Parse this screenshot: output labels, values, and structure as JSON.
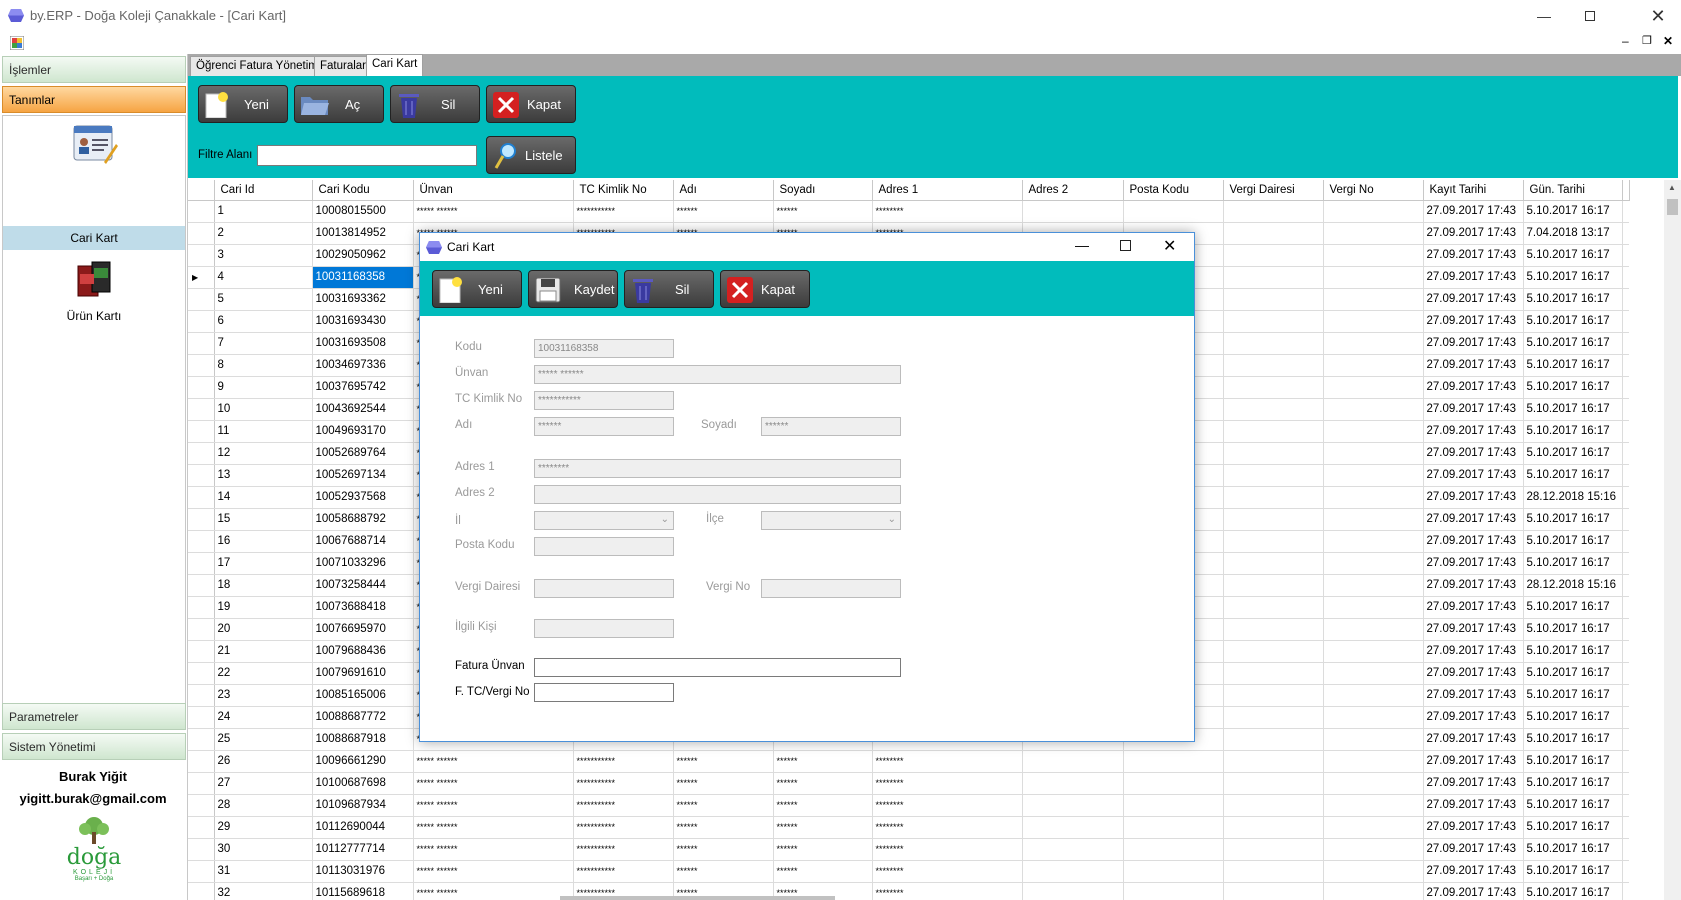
{
  "window": {
    "title": "by.ERP - Doğa Koleji Çanakkale - [Cari Kart]"
  },
  "sidebar": {
    "sections": [
      "İşlemler",
      "Tanımlar",
      "Parametreler",
      "Sistem Yönetimi"
    ],
    "items": [
      "Cari Kart",
      "Ürün Kartı"
    ],
    "user_name": "Burak Yiğit",
    "user_email": "yigitt.burak@gmail.com",
    "logo_text": "doğa",
    "logo_sub": "KOLEJİ",
    "logo_tag": "Başarı + Doğa"
  },
  "tabs": [
    "Öğrenci Fatura Yönetimi",
    "Faturalar",
    "Cari Kart"
  ],
  "toolbar": {
    "new": "Yeni",
    "open": "Aç",
    "delete": "Sil",
    "close": "Kapat"
  },
  "filter": {
    "label": "Filtre Alanı",
    "value": "",
    "list_button": "Listele"
  },
  "grid": {
    "columns": [
      "Cari Id",
      "Cari Kodu",
      "Ünvan",
      "TC Kimlik No",
      "Adı",
      "Soyadı",
      "Adres 1",
      "Adres 2",
      "Posta Kodu",
      "Vergi Dairesi",
      "Vergi No",
      "Kayıt Tarihi",
      "Gün. Tarihi"
    ],
    "rows": [
      [
        "1",
        "10008015500",
        "***** ******",
        "***********",
        "******",
        "******",
        "********",
        "",
        "",
        "",
        "",
        "27.09.2017 17:43",
        "5.10.2017 16:17"
      ],
      [
        "2",
        "10013814952",
        "***** ******",
        "***********",
        "******",
        "******",
        "********",
        "",
        "",
        "",
        "",
        "27.09.2017 17:43",
        "7.04.2018 13:17"
      ],
      [
        "3",
        "10029050962",
        "***** ******",
        "***********",
        "******",
        "******",
        "********",
        "",
        "",
        "",
        "",
        "27.09.2017 17:43",
        "5.10.2017 16:17"
      ],
      [
        "4",
        "10031168358",
        "***** ******",
        "***********",
        "******",
        "******",
        "********",
        "",
        "",
        "",
        "",
        "27.09.2017 17:43",
        "5.10.2017 16:17"
      ],
      [
        "5",
        "10031693362",
        "***** ******",
        "***********",
        "******",
        "******",
        "********",
        "",
        "",
        "",
        "",
        "27.09.2017 17:43",
        "5.10.2017 16:17"
      ],
      [
        "6",
        "10031693430",
        "***** ******",
        "***********",
        "******",
        "******",
        "********",
        "",
        "",
        "",
        "",
        "27.09.2017 17:43",
        "5.10.2017 16:17"
      ],
      [
        "7",
        "10031693508",
        "***** ******",
        "***********",
        "******",
        "******",
        "********",
        "",
        "",
        "",
        "",
        "27.09.2017 17:43",
        "5.10.2017 16:17"
      ],
      [
        "8",
        "10034697336",
        "***** ******",
        "***********",
        "******",
        "******",
        "********",
        "",
        "",
        "",
        "",
        "27.09.2017 17:43",
        "5.10.2017 16:17"
      ],
      [
        "9",
        "10037695742",
        "***** ******",
        "***********",
        "******",
        "******",
        "********",
        "",
        "",
        "",
        "",
        "27.09.2017 17:43",
        "5.10.2017 16:17"
      ],
      [
        "10",
        "10043692544",
        "***** ******",
        "***********",
        "******",
        "******",
        "********",
        "",
        "",
        "",
        "",
        "27.09.2017 17:43",
        "5.10.2017 16:17"
      ],
      [
        "11",
        "10049693170",
        "***** ******",
        "***********",
        "******",
        "******",
        "********",
        "",
        "",
        "",
        "",
        "27.09.2017 17:43",
        "5.10.2017 16:17"
      ],
      [
        "12",
        "10052689764",
        "***** ******",
        "***********",
        "******",
        "******",
        "********",
        "",
        "",
        "",
        "",
        "27.09.2017 17:43",
        "5.10.2017 16:17"
      ],
      [
        "13",
        "10052697134",
        "***** ******",
        "***********",
        "******",
        "******",
        "********",
        "",
        "",
        "",
        "",
        "27.09.2017 17:43",
        "5.10.2017 16:17"
      ],
      [
        "14",
        "10052937568",
        "***** ******",
        "***********",
        "******",
        "******",
        "********",
        "",
        "",
        "",
        "",
        "27.09.2017 17:43",
        "28.12.2018 15:16"
      ],
      [
        "15",
        "10058688792",
        "***** ******",
        "***********",
        "******",
        "******",
        "********",
        "",
        "",
        "",
        "",
        "27.09.2017 17:43",
        "5.10.2017 16:17"
      ],
      [
        "16",
        "10067688714",
        "***** ******",
        "***********",
        "******",
        "******",
        "********",
        "",
        "",
        "",
        "",
        "27.09.2017 17:43",
        "5.10.2017 16:17"
      ],
      [
        "17",
        "10071033296",
        "***** ******",
        "***********",
        "******",
        "******",
        "********",
        "",
        "",
        "",
        "",
        "27.09.2017 17:43",
        "5.10.2017 16:17"
      ],
      [
        "18",
        "10073258444",
        "***** ******",
        "***********",
        "******",
        "******",
        "********",
        "",
        "",
        "",
        "",
        "27.09.2017 17:43",
        "28.12.2018 15:16"
      ],
      [
        "19",
        "10073688418",
        "***** ******",
        "***********",
        "******",
        "******",
        "********",
        "",
        "",
        "",
        "",
        "27.09.2017 17:43",
        "5.10.2017 16:17"
      ],
      [
        "20",
        "10076695970",
        "***** ******",
        "***********",
        "******",
        "******",
        "********",
        "",
        "",
        "",
        "",
        "27.09.2017 17:43",
        "5.10.2017 16:17"
      ],
      [
        "21",
        "10079688436",
        "***** ******",
        "***********",
        "******",
        "******",
        "********",
        "",
        "",
        "",
        "",
        "27.09.2017 17:43",
        "5.10.2017 16:17"
      ],
      [
        "22",
        "10079691610",
        "***** ******",
        "***********",
        "******",
        "******",
        "********",
        "",
        "",
        "",
        "",
        "27.09.2017 17:43",
        "5.10.2017 16:17"
      ],
      [
        "23",
        "10085165006",
        "***** ******",
        "***********",
        "******",
        "******",
        "********",
        "",
        "",
        "",
        "",
        "27.09.2017 17:43",
        "5.10.2017 16:17"
      ],
      [
        "24",
        "10088687772",
        "***** ******",
        "***********",
        "******",
        "******",
        "********",
        "",
        "",
        "",
        "",
        "27.09.2017 17:43",
        "5.10.2017 16:17"
      ],
      [
        "25",
        "10088687918",
        "***** ******",
        "***********",
        "******",
        "******",
        "********",
        "",
        "",
        "",
        "",
        "27.09.2017 17:43",
        "5.10.2017 16:17"
      ],
      [
        "26",
        "10096661290",
        "***** ******",
        "***********",
        "******",
        "******",
        "********",
        "",
        "",
        "",
        "",
        "27.09.2017 17:43",
        "5.10.2017 16:17"
      ],
      [
        "27",
        "10100687698",
        "***** ******",
        "***********",
        "******",
        "******",
        "********",
        "",
        "",
        "",
        "",
        "27.09.2017 17:43",
        "5.10.2017 16:17"
      ],
      [
        "28",
        "10109687934",
        "***** ******",
        "***********",
        "******",
        "******",
        "********",
        "",
        "",
        "",
        "",
        "27.09.2017 17:43",
        "5.10.2017 16:17"
      ],
      [
        "29",
        "10112690044",
        "***** ******",
        "***********",
        "******",
        "******",
        "********",
        "",
        "",
        "",
        "",
        "27.09.2017 17:43",
        "5.10.2017 16:17"
      ],
      [
        "30",
        "10112777714",
        "***** ******",
        "***********",
        "******",
        "******",
        "********",
        "",
        "",
        "",
        "",
        "27.09.2017 17:43",
        "5.10.2017 16:17"
      ],
      [
        "31",
        "10113031976",
        "***** ******",
        "***********",
        "******",
        "******",
        "********",
        "",
        "",
        "",
        "",
        "27.09.2017 17:43",
        "5.10.2017 16:17"
      ],
      [
        "32",
        "10115689618",
        "***** ******",
        "***********",
        "******",
        "******",
        "********",
        "",
        "",
        "",
        "",
        "27.09.2017 17:43",
        "5.10.2017 16:17"
      ]
    ],
    "selected_row_index": 3
  },
  "dialog": {
    "title": "Cari Kart",
    "buttons": {
      "new": "Yeni",
      "save": "Kaydet",
      "delete": "Sil",
      "close": "Kapat"
    },
    "labels": {
      "code": "Kodu",
      "title": "Ünvan",
      "tc": "TC Kimlik No",
      "name": "Adı",
      "surname": "Soyadı",
      "address1": "Adres 1",
      "address2": "Adres 2",
      "city": "İl",
      "district": "İlçe",
      "postal": "Posta Kodu",
      "tax_office": "Vergi Dairesi",
      "tax_no": "Vergi No",
      "contact": "İlgili Kişi",
      "invoice_title": "Fatura Ünvan",
      "invoice_tax": "F. TC/Vergi No"
    },
    "values": {
      "code": "10031168358",
      "title": "***** ******",
      "tc": "***********",
      "name": "******",
      "surname": "******",
      "address1": "********",
      "address2": "",
      "postal": "",
      "tax_office": "",
      "tax_no": "",
      "contact": "",
      "invoice_title": "",
      "invoice_tax": ""
    }
  },
  "colors": {
    "toolbar_teal": "#01bcbc",
    "selection": "#0078d7",
    "active_section": "#f6a443"
  }
}
